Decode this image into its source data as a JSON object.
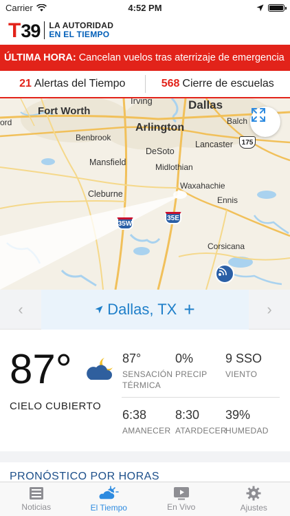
{
  "status": {
    "carrier": "Carrier",
    "time": "4:52 PM",
    "battery_level": 1.0
  },
  "header": {
    "logo_letter": "T",
    "logo_number": "39",
    "tagline_line1": "LA AUTORIDAD",
    "tagline_line2": "EN EL TIEMPO"
  },
  "breaking": {
    "label": "ÚLTIMA HORA:",
    "text": "Cancelan vuelos tras aterrizaje de emergencia"
  },
  "alerts": {
    "weather_count": "21",
    "weather_label": "Alertas del Tiempo",
    "school_count": "568",
    "school_label": "Cierre de escuelas"
  },
  "map": {
    "labels": {
      "irving": "Irving",
      "ford": "ord",
      "fort_worth": "Fort Worth",
      "dallas": "Dallas",
      "balch": "Balch",
      "arlington": "Arlington",
      "benbrook": "Benbrook",
      "desoto": "DeSoto",
      "lancaster": "Lancaster",
      "mansfield": "Mansfield",
      "midlothian": "Midlothian",
      "waxahachie": "Waxahachie",
      "ennis": "Ennis",
      "cleburne": "Cleburne",
      "corsicana": "Corsicana"
    },
    "shields": {
      "i35w": "35W",
      "i35e": "35E",
      "us175": "175"
    }
  },
  "location": {
    "name": "Dallas, TX",
    "add": "+",
    "prev": "‹",
    "next": "›"
  },
  "current": {
    "temperature": "87°",
    "condition": "CIELO CUBIERTO",
    "feels_like_value": "87°",
    "feels_like_label_1": "SENSACIÓN",
    "feels_like_label_2": "TÉRMICA",
    "precip_value": "0%",
    "precip_label": "PRECIP",
    "wind_value": "9 SSO",
    "wind_label": "VIENTO",
    "sunrise_value": "6:38",
    "sunrise_label": "AMANECER",
    "sunset_value": "8:30",
    "sunset_label": "ATARDECER",
    "humidity_value": "39%",
    "humidity_label": "HUMEDAD",
    "icon": "partly-cloudy-night-icon"
  },
  "hourly": {
    "title": "PRONÓSTICO POR HORAS"
  },
  "tabs": [
    {
      "label": "Noticias",
      "icon": "news-icon"
    },
    {
      "label": "El Tiempo",
      "icon": "weather-sun-icon"
    },
    {
      "label": "En Vivo",
      "icon": "play-video-icon"
    },
    {
      "label": "Ajustes",
      "icon": "gear-icon"
    }
  ],
  "colors": {
    "brand_red": "#e2231a",
    "brand_blue": "#005eb8",
    "accent_blue": "#2e8be0"
  }
}
